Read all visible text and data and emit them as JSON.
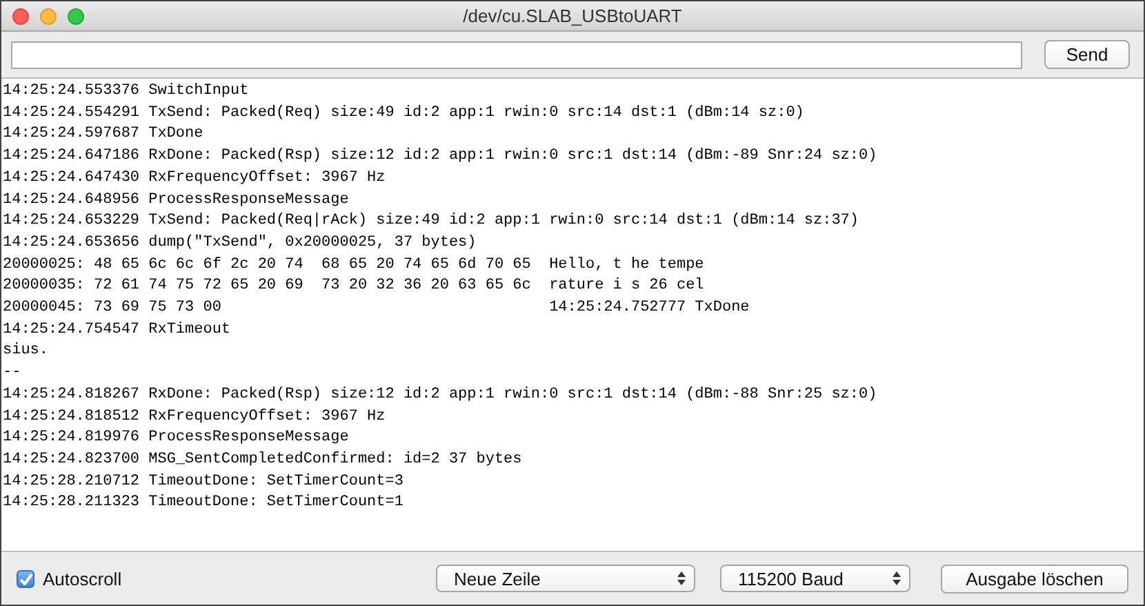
{
  "window": {
    "title": "/dev/cu.SLAB_USBtoUART"
  },
  "send_button": "Send",
  "output_lines": [
    "14:25:24.553376 SwitchInput",
    "14:25:24.554291 TxSend: Packed(Req) size:49 id:2 app:1 rwin:0 src:14 dst:1 (dBm:14 sz:0)",
    "14:25:24.597687 TxDone",
    "14:25:24.647186 RxDone: Packed(Rsp) size:12 id:2 app:1 rwin:0 src:1 dst:14 (dBm:-89 Snr:24 sz:0)",
    "14:25:24.647430 RxFrequencyOffset: 3967 Hz",
    "14:25:24.648956 ProcessResponseMessage",
    "14:25:24.653229 TxSend: Packed(Req|rAck) size:49 id:2 app:1 rwin:0 src:14 dst:1 (dBm:14 sz:37)",
    "14:25:24.653656 dump(\"TxSend\", 0x20000025, 37 bytes)",
    "20000025: 48 65 6c 6c 6f 2c 20 74  68 65 20 74 65 6d 70 65  Hello, t he tempe",
    "20000035: 72 61 74 75 72 65 20 69  73 20 32 36 20 63 65 6c  rature i s 26 cel",
    "20000045: 73 69 75 73 00                                    14:25:24.752777 TxDone",
    "14:25:24.754547 RxTimeout",
    "sius.",
    "--",
    "14:25:24.818267 RxDone: Packed(Rsp) size:12 id:2 app:1 rwin:0 src:1 dst:14 (dBm:-88 Snr:25 sz:0)",
    "14:25:24.818512 RxFrequencyOffset: 3967 Hz",
    "14:25:24.819976 ProcessResponseMessage",
    "14:25:24.823700 MSG_SentCompletedConfirmed: id=2 37 bytes",
    "14:25:28.210712 TimeoutDone: SetTimerCount=3",
    "14:25:28.211323 TimeoutDone: SetTimerCount=1"
  ],
  "autoscroll": {
    "label": "Autoscroll",
    "checked": true
  },
  "line_ending": {
    "value": "Neue Zeile"
  },
  "baud": {
    "value": "115200 Baud"
  },
  "clear_button": "Ausgabe löschen"
}
